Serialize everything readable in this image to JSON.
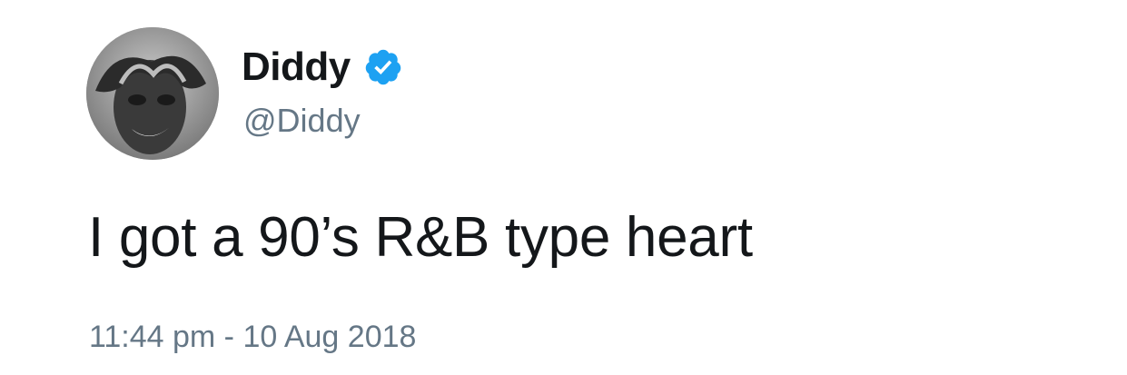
{
  "author": {
    "display_name": "Diddy",
    "handle": "@Diddy",
    "verified": true,
    "avatar_icon": "profile-photo-heart-hands",
    "verified_icon": "verified-badge-icon",
    "verified_color": "#1da1f2"
  },
  "tweet": {
    "text": "I got a 90’s R&B type heart",
    "timestamp": "11:44 pm - 10 Aug 2018"
  },
  "colors": {
    "text_primary": "#14171a",
    "text_secondary": "#657786",
    "background": "#ffffff"
  }
}
